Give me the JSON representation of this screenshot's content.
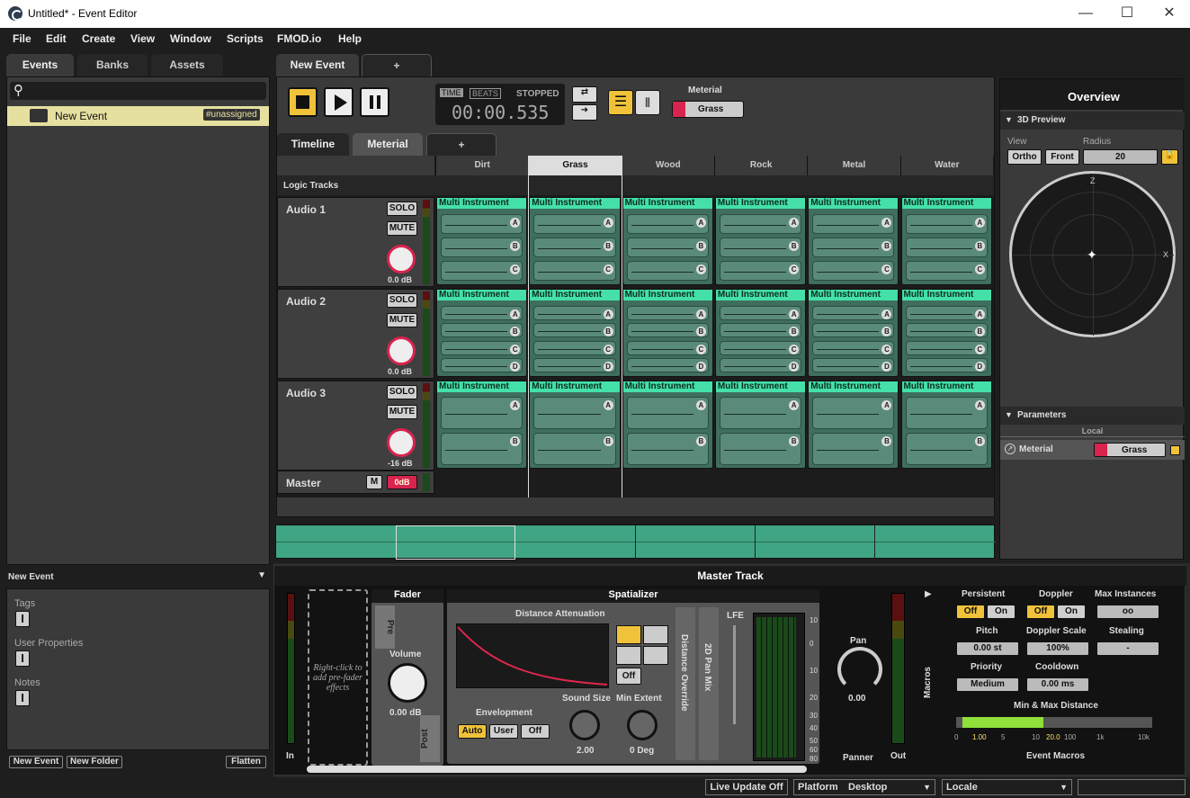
{
  "window": {
    "title": "Untitled* - Event Editor",
    "min": "—",
    "max": "☐",
    "close": "✕"
  },
  "menu": [
    "File",
    "Edit",
    "Create",
    "View",
    "Window",
    "Scripts",
    "FMOD.io",
    "Help"
  ],
  "left": {
    "tabs": [
      "Events",
      "Banks",
      "Assets"
    ],
    "event_name": "New Event",
    "event_tag": "#unassigned",
    "details_title": "New Event",
    "tags": "Tags",
    "user_properties": "User Properties",
    "notes": "Notes",
    "btn_new_event": "New Event",
    "btn_new_folder": "New Folder",
    "btn_flatten": "Flatten"
  },
  "editor": {
    "tab": "New Event",
    "tab_add": "+",
    "transport": {
      "time": "TIME",
      "beats": "BEATS",
      "state": "STOPPED",
      "clock": "00:00.535"
    },
    "param_label": "Meterial",
    "param_value": "Grass",
    "subtabs": [
      "Timeline",
      "Meterial"
    ],
    "subtab_add": "+",
    "columns": [
      "Dirt",
      "Grass",
      "Wood",
      "Rock",
      "Metal",
      "Water"
    ],
    "logic_tracks": "Logic Tracks",
    "tracks": [
      {
        "name": "Audio 1",
        "solo": "SOLO",
        "mute": "MUTE",
        "db": "0.0 dB",
        "slots": [
          "A",
          "B",
          "C"
        ]
      },
      {
        "name": "Audio 2",
        "solo": "SOLO",
        "mute": "MUTE",
        "db": "0.0 dB",
        "slots": [
          "A",
          "B",
          "C",
          "D"
        ]
      },
      {
        "name": "Audio 3",
        "solo": "SOLO",
        "mute": "MUTE",
        "db": "-16 dB",
        "slots": [
          "A",
          "B"
        ]
      }
    ],
    "multi_instrument": "Multi Instrument",
    "master": {
      "name": "Master",
      "m": "M",
      "db": "0dB"
    }
  },
  "overview": {
    "title": "Overview",
    "preview": "3D Preview",
    "view": "View",
    "radius": "Radius",
    "ortho": "Ortho",
    "front": "Front",
    "radius_val": "20",
    "axis_z": "Z",
    "axis_x": "X",
    "parameters": "Parameters",
    "local": "Local",
    "param_name": "Meterial",
    "param_val": "Grass"
  },
  "master_track": {
    "title": "Master Track",
    "in": "In",
    "out": "Out",
    "prefader": "Right-click to add pre-fader effects",
    "fader": "Fader",
    "pre": "Pre",
    "post": "Post",
    "volume": "Volume",
    "volume_val": "0.00 dB",
    "spatializer": "Spatializer",
    "dist_att": "Distance Attenuation",
    "envelopment": "Envelopment",
    "env_opts": [
      "Auto",
      "User",
      "Off"
    ],
    "off": "Off",
    "sound_size": "Sound Size",
    "sound_size_val": "2.00",
    "min_extent": "Min Extent",
    "min_extent_val": "0 Deg",
    "dist_override": "Distance Override",
    "pan_mix": "2D Pan Mix",
    "lfe": "LFE",
    "meter_ticks": [
      "10",
      "0",
      "10",
      "20",
      "30",
      "40",
      "50",
      "60",
      "80"
    ],
    "pan": "Pan",
    "pan_val": "0.00",
    "panner": "Panner",
    "macros": "Macros"
  },
  "macros": {
    "persistent": "Persistent",
    "doppler": "Doppler",
    "max_instances": "Max Instances",
    "off": "Off",
    "on": "On",
    "max_val": "oo",
    "pitch": "Pitch",
    "pitch_val": "0.00 st",
    "doppler_scale": "Doppler Scale",
    "doppler_val": "100%",
    "stealing": "Stealing",
    "stealing_val": "-",
    "priority": "Priority",
    "priority_val": "Medium",
    "cooldown": "Cooldown",
    "cooldown_val": "0.00 ms",
    "minmax": "Min & Max Distance",
    "ticks": [
      "0",
      "1.00",
      "5",
      "10",
      "20.0",
      "100",
      "1k",
      "10k"
    ],
    "title": "Event Macros"
  },
  "status": {
    "live_update": "Live Update Off",
    "platform": "Platform",
    "platform_val": "Desktop",
    "locale": "Locale"
  }
}
